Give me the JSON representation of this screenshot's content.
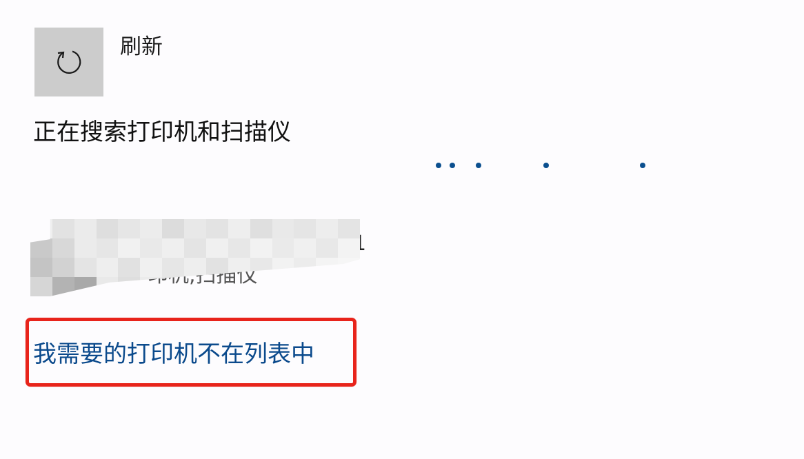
{
  "refresh": {
    "icon": "refresh-icon",
    "label": "刷新"
  },
  "status": {
    "searching_text": "正在搜索打印机和扫描仪",
    "progress_icon": "loading-dots-icon",
    "dot_color": "#0b4f8f"
  },
  "device": {
    "name_tail": "1",
    "subtitle": "印机,扫描仪",
    "redacted": true
  },
  "link": {
    "label": "我需要的打印机不在列表中",
    "color": "#0b4a8c"
  },
  "highlight": {
    "color": "#e8241b"
  }
}
